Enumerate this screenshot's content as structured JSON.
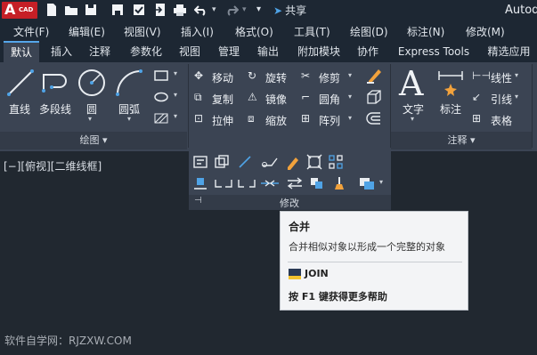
{
  "app": {
    "logo_text": "A",
    "logo_sub": "CAD",
    "title": "Autod"
  },
  "quick_access": {
    "share_label": "共享"
  },
  "menu": [
    "文件(F)",
    "编辑(E)",
    "视图(V)",
    "插入(I)",
    "格式(O)",
    "工具(T)",
    "绘图(D)",
    "标注(N)",
    "修改(M)"
  ],
  "tabs": [
    "默认",
    "插入",
    "注释",
    "参数化",
    "视图",
    "管理",
    "输出",
    "附加模块",
    "协作",
    "Express Tools",
    "精选应用"
  ],
  "draw_panel": {
    "tools": [
      "直线",
      "多段线",
      "圆",
      "圆弧"
    ],
    "footer": "绘图 ▾"
  },
  "modify_panel": {
    "tools": [
      "移动",
      "旋转",
      "修剪",
      "复制",
      "镜像",
      "圆角",
      "拉伸",
      "缩放",
      "阵列"
    ],
    "footer": "修改"
  },
  "annotation_panel": {
    "tools": [
      "文字",
      "标注",
      "线性",
      "引线",
      "表格"
    ],
    "footer": "注释 ▾"
  },
  "viewport": {
    "label": "[−][俯视][二维线框]"
  },
  "tooltip": {
    "title": "合并",
    "description": "合并相似对象以形成一个完整的对象",
    "command": "JOIN",
    "help": "按 F1 键获得更多帮助"
  },
  "watermark": "软件自学网：RJZXW.COM",
  "colors": {
    "accent": "#55a6ea",
    "brand": "#c61f26",
    "ribbon": "#3b4453",
    "background": "#212830"
  }
}
